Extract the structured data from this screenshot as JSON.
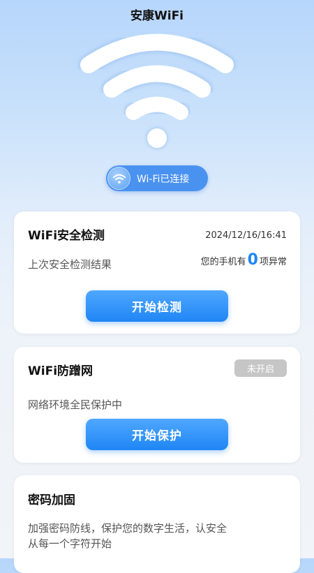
{
  "app": {
    "title": "安康WiFi"
  },
  "status": {
    "label": "Wi-Fi已连接"
  },
  "security_check": {
    "title": "WiFi安全检测",
    "timestamp": "2024/12/16/16:41",
    "last_result_label": "上次安全检测结果",
    "abnormal_prefix": "您的手机有",
    "abnormal_count": "0",
    "abnormal_suffix": "项异常",
    "button_label": "开始检测"
  },
  "anti_leech": {
    "title": "WiFi防蹭网",
    "badge": "未开启",
    "desc": "网络环境全民保护中",
    "button_label": "开始保护"
  },
  "password": {
    "title": "密码加固",
    "desc_line1": "加强密码防线，保护您的数字生活，认安全",
    "desc_line2": "从每一个字符开始"
  },
  "colors": {
    "accent": "#1f86f5",
    "pill": "#4a92f0",
    "badge": "#c6c6c6"
  },
  "icons": {
    "hero": "wifi-large-icon",
    "pill": "wifi-small-icon"
  }
}
